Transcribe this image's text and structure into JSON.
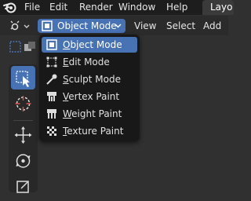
{
  "top_menu": {
    "items": [
      "File",
      "Edit",
      "Render",
      "Window",
      "Help"
    ],
    "workspace_tab": "Layo"
  },
  "header": {
    "mode_selector": "Object Mode",
    "menus": [
      "View",
      "Select",
      "Add"
    ]
  },
  "mode_menu": {
    "items": [
      {
        "label": "Object Mode",
        "mnemonic": "O",
        "rest": "bject Mode",
        "icon": "object-mode-icon",
        "active": true
      },
      {
        "label": "Edit Mode",
        "mnemonic": "E",
        "rest": "dit Mode",
        "icon": "edit-mode-icon",
        "active": false
      },
      {
        "label": "Sculpt Mode",
        "mnemonic": "S",
        "rest": "culpt Mode",
        "icon": "sculpt-mode-icon",
        "active": false
      },
      {
        "label": "Vertex Paint",
        "mnemonic": "V",
        "rest": "ertex Paint",
        "icon": "vertex-paint-icon",
        "active": false
      },
      {
        "label": "Weight Paint",
        "mnemonic": "W",
        "rest": "eight Paint",
        "icon": "weight-paint-icon",
        "active": false
      },
      {
        "label": "Texture Paint",
        "mnemonic": "T",
        "rest": "exture Paint",
        "icon": "texture-paint-icon",
        "active": false
      }
    ]
  },
  "toolbar": {
    "tools": [
      "select-box-icon",
      "cursor-icon",
      "move-icon",
      "rotate-icon",
      "scale-icon"
    ],
    "active_tool": "select-box-icon"
  },
  "colors": {
    "accent": "#4772b3",
    "background": "#303030",
    "topbar": "#1d1d1d",
    "menu": "#181818"
  }
}
